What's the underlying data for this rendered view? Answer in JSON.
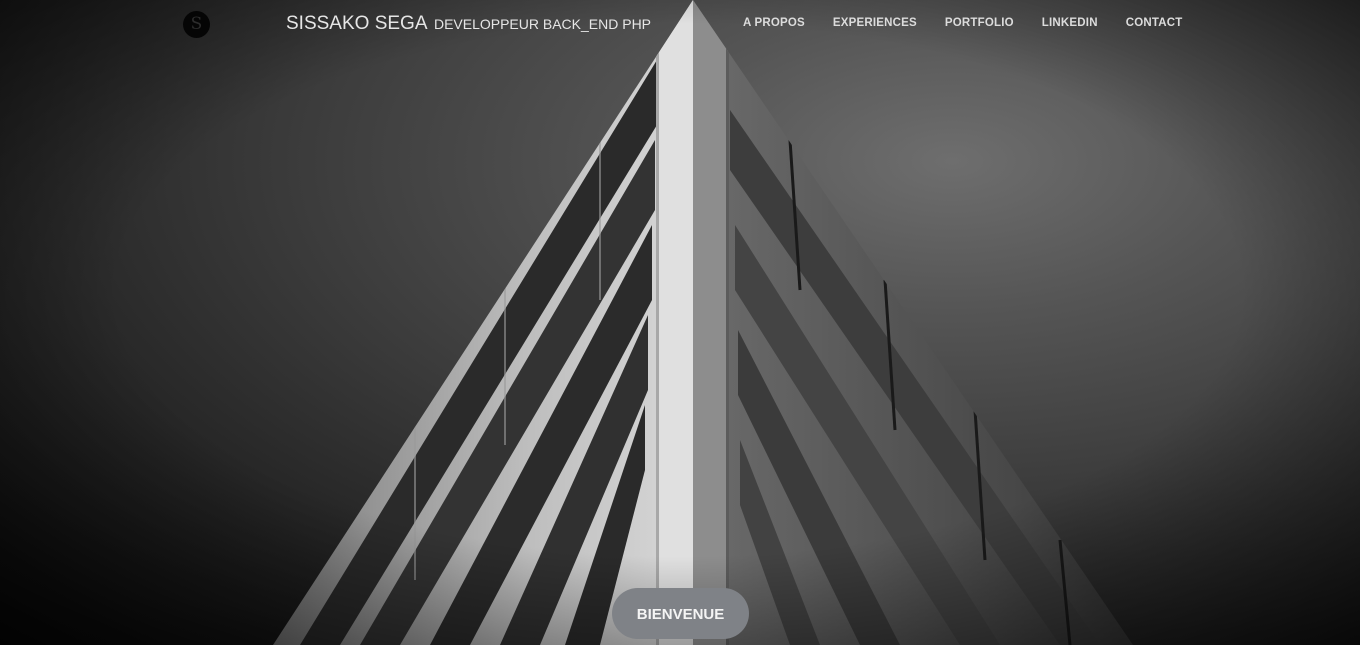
{
  "header": {
    "logo_letter": "S",
    "brand_name": "SISSAKO SEGA",
    "brand_role": "DEVELOPPEUR BACK_END PHP"
  },
  "nav": {
    "items": [
      {
        "label": "A PROPOS"
      },
      {
        "label": "EXPERIENCES"
      },
      {
        "label": "PORTFOLIO"
      },
      {
        "label": "LINKEDIN"
      },
      {
        "label": "CONTACT"
      }
    ]
  },
  "hero": {
    "cta_label": "BIENVENUE"
  }
}
